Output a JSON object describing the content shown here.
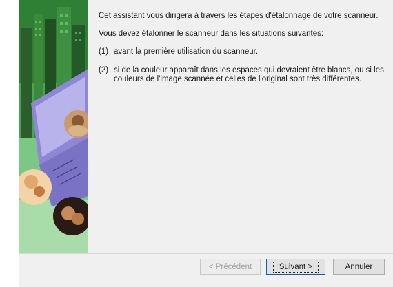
{
  "wizard": {
    "intro": "Cet assistant vous dirigera à travers les étapes d'étalonnage de votre scanneur.",
    "lead": "Vous devez étalonner le scanneur dans les situations suivantes:",
    "items": [
      {
        "num": "(1)",
        "text": "avant la première utilisation du scanneur."
      },
      {
        "num": "(2)",
        "text": "si de la couleur apparaît dans les espaces qui devraient être blancs, ou si les couleurs de l'image scannée et celles de l'original sont très différentes."
      }
    ]
  },
  "buttons": {
    "back": "< Précédent",
    "next": "Suivant >",
    "cancel": "Annuler"
  },
  "colors": {
    "banner_green": "#3d9b4a",
    "laptop_purple": "#8f86d6",
    "default_button_border": "#0f5fb5"
  }
}
